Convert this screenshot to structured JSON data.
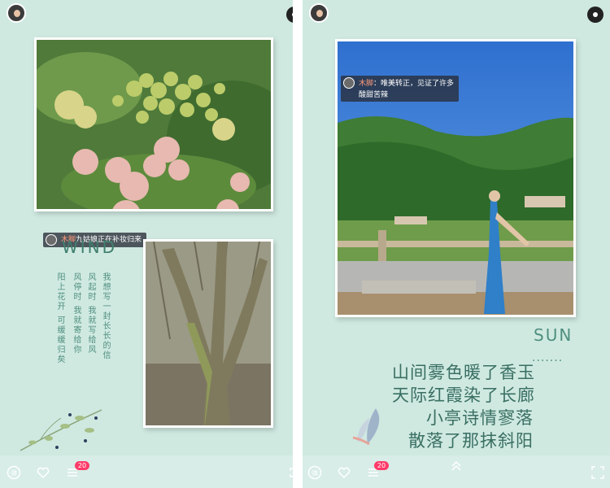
{
  "left": {
    "comment": {
      "name": "木脚",
      "text": "九姑娘正在补妆归来"
    },
    "heading": "WIND",
    "verse_columns": [
      "我想写一封长长的信",
      "风起时 我就写给风",
      "风停时 我就寄给你",
      "阳上花开 可缓缓归矣"
    ],
    "badge": "20"
  },
  "right": {
    "comment": {
      "name": "木脚",
      "line1": "：唯美转正，见证了许多",
      "line2": "酸甜苦辣"
    },
    "heading": "SUN",
    "dots": "·······",
    "poem": [
      "山间雾色暖了香玉",
      "天际红霞染了长廊",
      "小亭诗情寥落",
      "散落了那抹斜阳"
    ],
    "badge": "20"
  },
  "icons": [
    "user-avatar-icon",
    "music-disc-icon",
    "danmaku-icon",
    "heart-icon",
    "menu-icon",
    "fullscreen-icon",
    "chevron-up-icon"
  ],
  "colors": {
    "panel_bg": "#cfe9e1",
    "accent_text": "#4f8f7e",
    "badge": "#ff3b6a"
  }
}
